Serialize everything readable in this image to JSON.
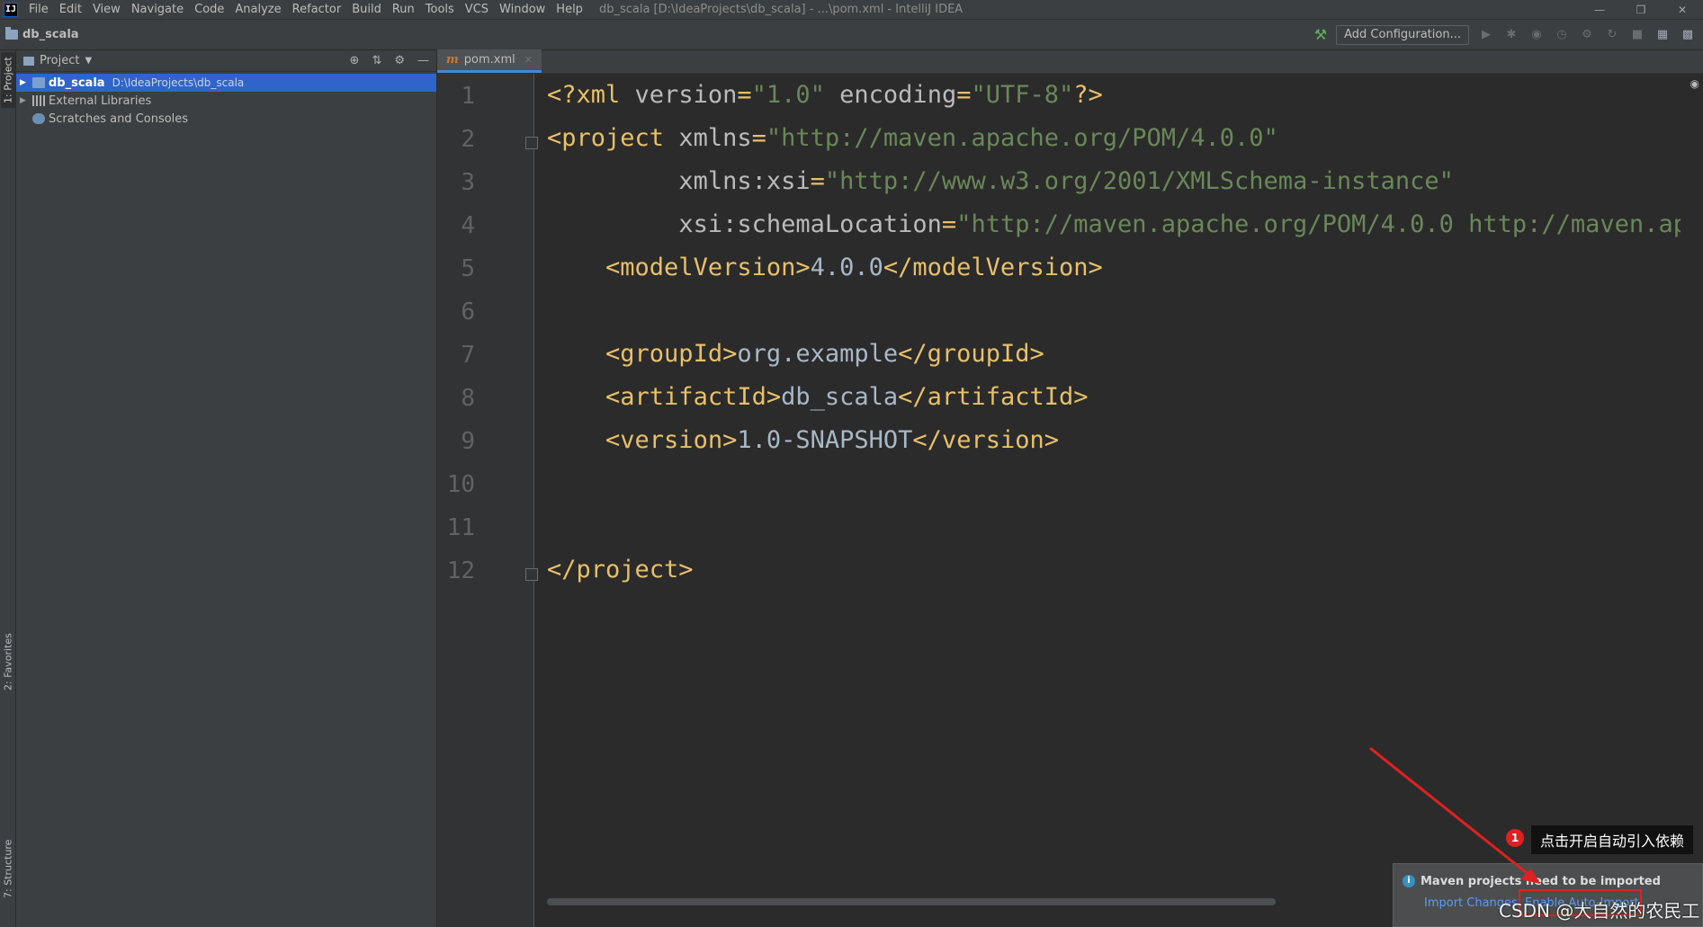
{
  "titlebar": {
    "menu": [
      "File",
      "Edit",
      "View",
      "Navigate",
      "Code",
      "Analyze",
      "Refactor",
      "Build",
      "Run",
      "Tools",
      "VCS",
      "Window",
      "Help"
    ],
    "window_title": "db_scala [D:\\IdeaProjects\\db_scala] - ...\\pom.xml - IntelliJ IDEA",
    "logo_text": "IJ"
  },
  "navbar": {
    "breadcrumb": "db_scala",
    "add_config_label": "Add Configuration..."
  },
  "left_strip": {
    "project_tab": "1: Project",
    "favorites_tab": "2: Favorites",
    "structure_tab": "7: Structure"
  },
  "project_panel": {
    "title": "Project",
    "tree": [
      {
        "label": "db_scala",
        "hint": "D:\\IdeaProjects\\db_scala",
        "selected": true
      },
      {
        "label": "External Libraries"
      },
      {
        "label": "Scratches and Consoles"
      }
    ]
  },
  "editor": {
    "tab_label": "pom.xml",
    "tab_icon": "m",
    "line_numbers": [
      "1",
      "2",
      "3",
      "4",
      "5",
      "6",
      "7",
      "8",
      "9",
      "10",
      "11",
      "12"
    ]
  },
  "notification": {
    "title": "Maven projects need to be imported",
    "import_changes": "Import Changes",
    "enable_auto_import": "Enable Auto-Import"
  },
  "annotation": {
    "badge": "1",
    "callout": "点击开启自动引入依赖",
    "watermark": "CSDN @大自然的农民工",
    "color": "#e02020"
  },
  "colors": {
    "tag": "#e8bf6a",
    "attr_value": "#6a8759",
    "selection": "#2f65ca",
    "link": "#589df6"
  }
}
